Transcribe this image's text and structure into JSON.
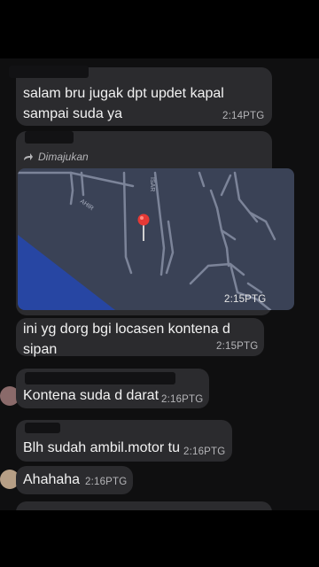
{
  "messages": [
    {
      "text": "salam bru jugak dpt updet kapal sampai suda ya",
      "time": "2:14PTG"
    },
    {
      "forward_label": "Dimajukan",
      "map_time": "2:15PTG",
      "map_label_1": "AHIR",
      "map_label_2": "ISAR"
    },
    {
      "text": "ini yg dorg bgi locasen kontena d sipan",
      "time": "2:15PTG"
    },
    {
      "text": "Kontena suda d darat",
      "time": "2:16PTG"
    },
    {
      "text": "Blh sudah ambil.motor tu",
      "time": "2:16PTG"
    },
    {
      "text": "Ahahaha",
      "time": "2:16PTG"
    }
  ],
  "colors": {
    "bubble": "#2b2b2e",
    "map_bg": "#3a4256",
    "water": "#2746a3",
    "pin": "#e53935"
  },
  "icons": {
    "forward": "forward-arrow-icon",
    "pin": "map-pin-icon"
  }
}
